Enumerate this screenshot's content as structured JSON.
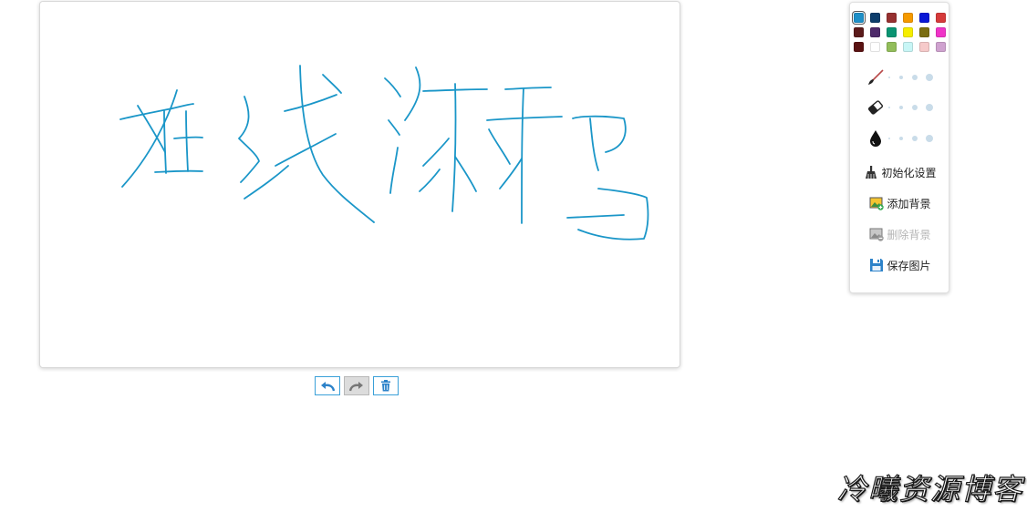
{
  "palette": [
    "#1e90c8",
    "#0c3d6b",
    "#963030",
    "#f59a00",
    "#0a18d6",
    "#d63a3a",
    "#5b1b1b",
    "#4e2a6a",
    "#0a9472",
    "#f6ee00",
    "#7a6d10",
    "#f034c8",
    "#5a1212",
    "#ffffff",
    "#92bd5a",
    "#c8f6f6",
    "#f6caca",
    "#cfa2cf"
  ],
  "selected_color": "#1e90c8",
  "stroke_color": "#1a96c8",
  "tools": {
    "brush": {
      "icon": "brush-icon"
    },
    "eraser": {
      "icon": "eraser-icon"
    },
    "ink": {
      "icon": "ink-drop-icon"
    }
  },
  "actions": {
    "init_label": "初始化设置",
    "add_bg_label": "添加背景",
    "delete_bg_label": "删除背景",
    "save_label": "保存图片"
  },
  "history": {
    "undo_icon": "undo-icon",
    "redo_icon": "redo-icon",
    "clear_icon": "trash-icon"
  },
  "watermark": "冷曦资源博客"
}
